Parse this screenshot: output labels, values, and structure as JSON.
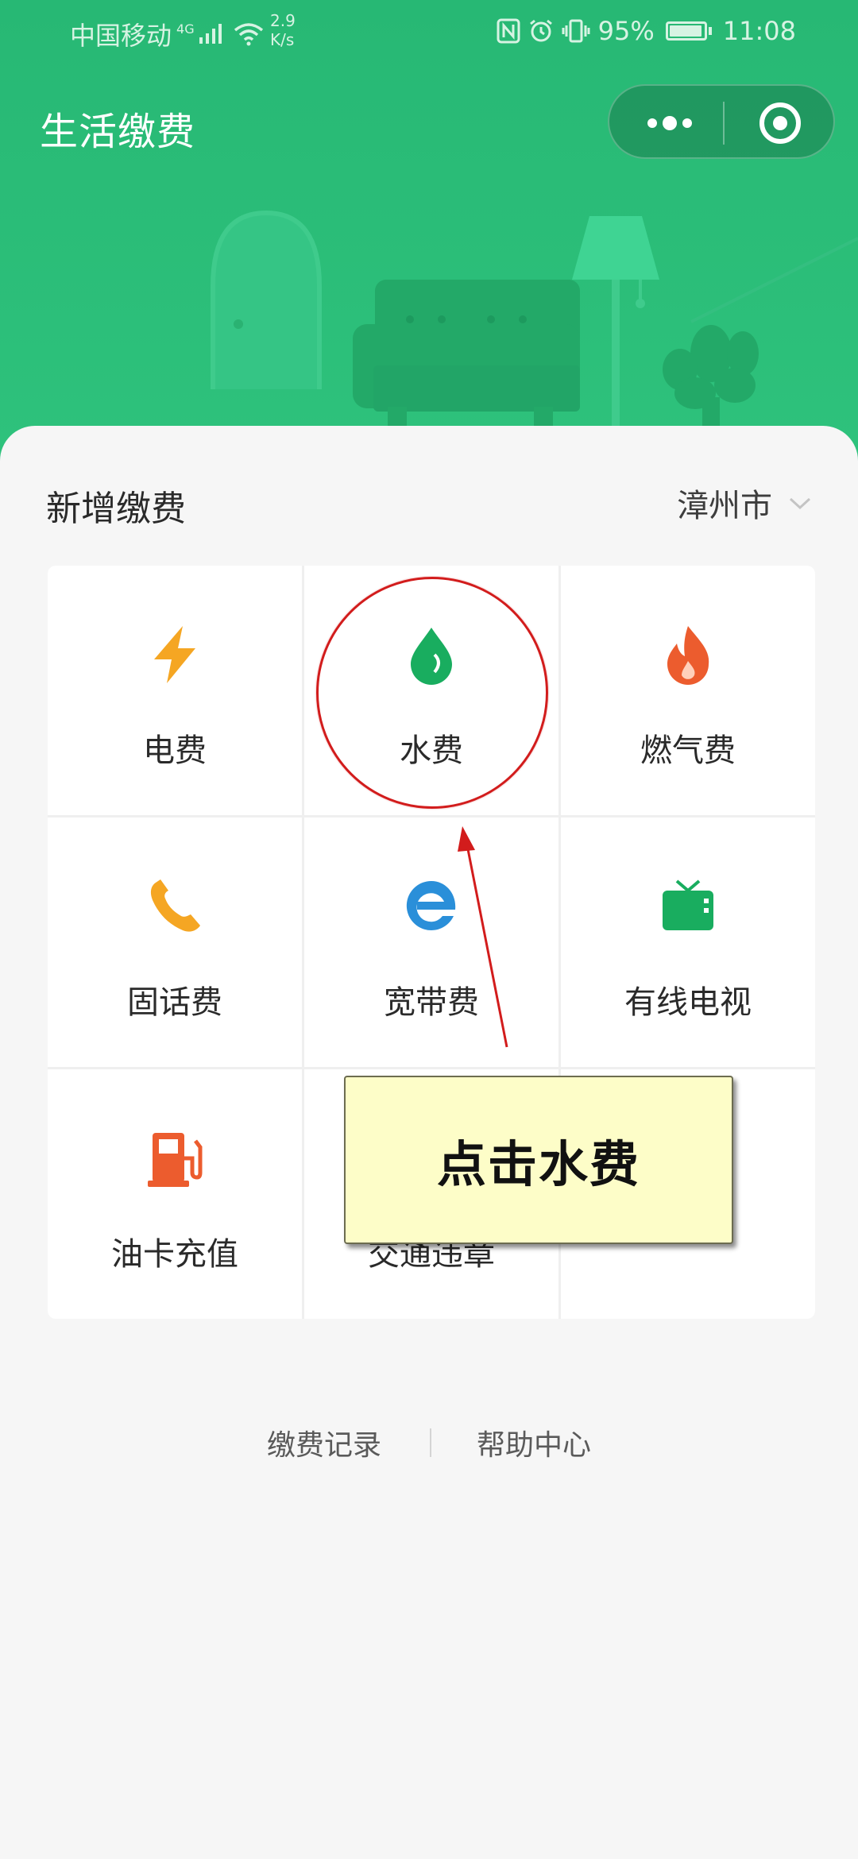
{
  "status_bar": {
    "carrier": "中国移动",
    "network_tag": "4G",
    "speed_value": "2.9",
    "speed_unit": "K/s",
    "battery_percent": "95%",
    "time": "11:08"
  },
  "header": {
    "title": "生活缴费",
    "capsule_more_icon": "more-dots-icon",
    "capsule_close_icon": "target-close-icon"
  },
  "section": {
    "title": "新增缴费",
    "city": "漳州市"
  },
  "services": [
    {
      "label": "电费",
      "icon": "lightning-icon",
      "color": "#f5a623"
    },
    {
      "label": "水费",
      "icon": "water-drop-icon",
      "color": "#19ad5f"
    },
    {
      "label": "燃气费",
      "icon": "flame-icon",
      "color": "#ec5c2e"
    },
    {
      "label": "固话费",
      "icon": "phone-icon",
      "color": "#f5a623"
    },
    {
      "label": "宽带费",
      "icon": "broadband-e-icon",
      "color": "#2a8fd9"
    },
    {
      "label": "有线电视",
      "icon": "tv-icon",
      "color": "#19ad5f"
    },
    {
      "label": "油卡充值",
      "icon": "fuel-pump-icon",
      "color": "#ec5c2e"
    },
    {
      "label": "交通违章",
      "icon": "traffic-icon",
      "color": "#2a8fd9"
    },
    {
      "label": "",
      "icon": "",
      "color": ""
    }
  ],
  "links": {
    "records": "缴费记录",
    "help": "帮助中心"
  },
  "annotation": {
    "callout_text": "点击水费"
  },
  "colors": {
    "header_green": "#2ebd79",
    "highlight_red": "#d21c1c",
    "callout_bg": "#fdfdc8"
  }
}
